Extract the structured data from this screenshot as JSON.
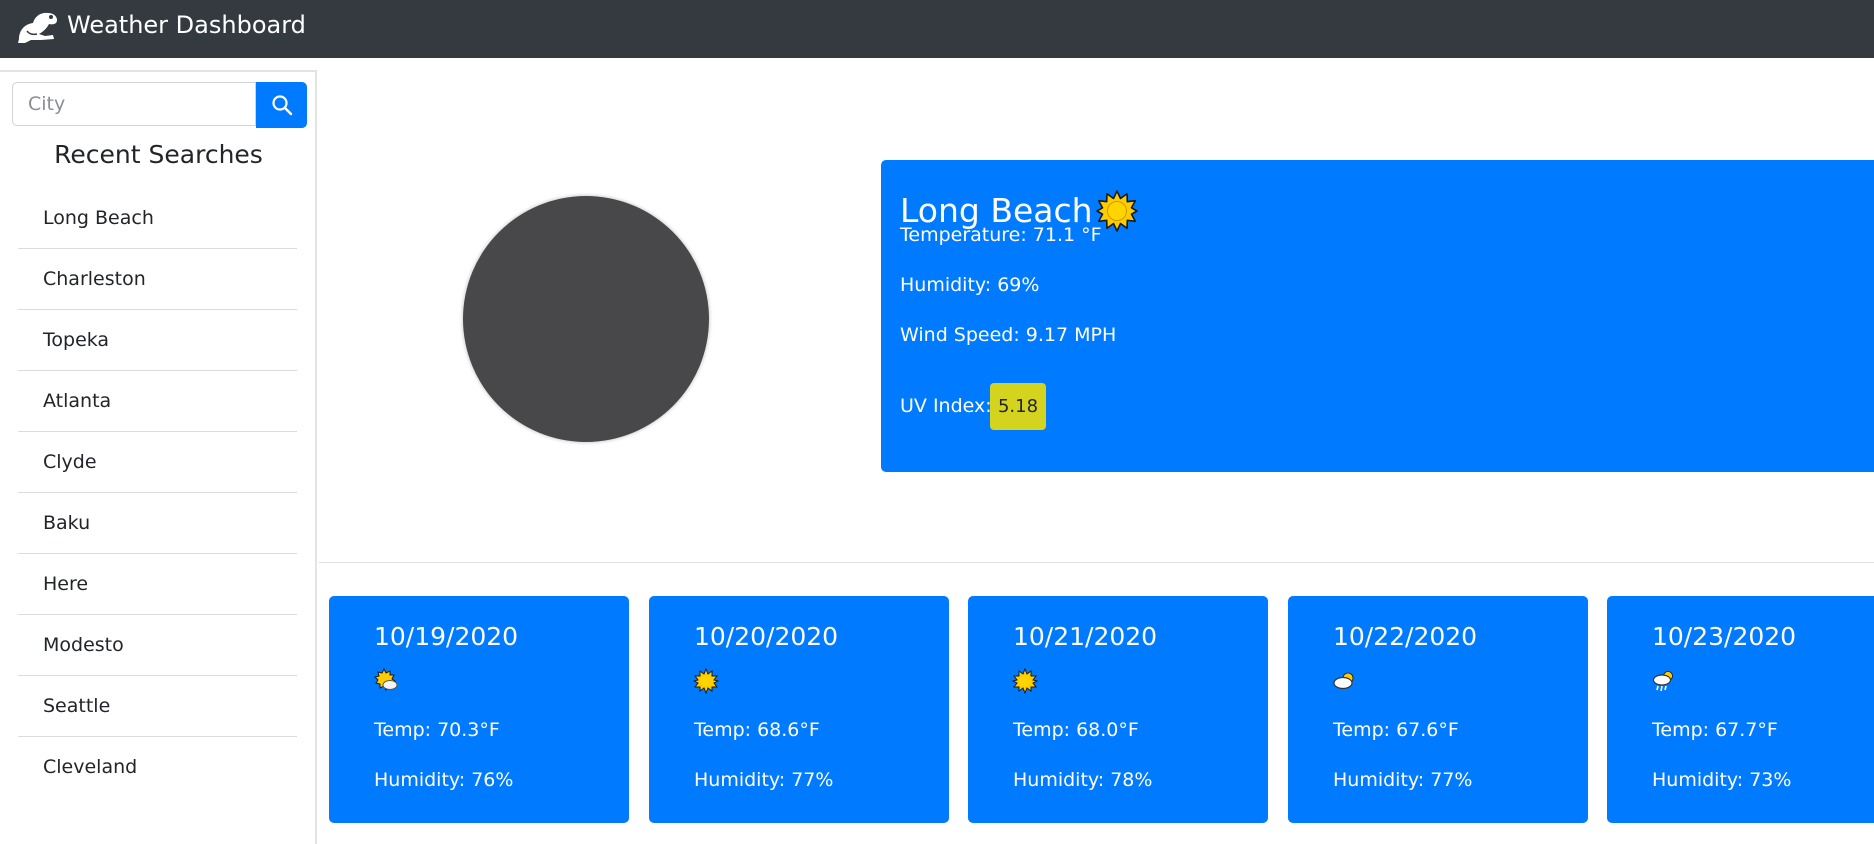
{
  "header": {
    "title": "Weather Dashboard",
    "logo_icon": "frog-icon"
  },
  "search": {
    "placeholder": "City",
    "value": "",
    "button_icon": "search-icon"
  },
  "recent": {
    "title": "Recent Searches",
    "items": [
      "Long Beach",
      "Charleston",
      "Topeka",
      "Atlanta",
      "Clyde",
      "Baku",
      "Here",
      "Modesto",
      "Seattle",
      "Cleveland"
    ]
  },
  "current": {
    "city": "Long Beach",
    "icon": "sun-icon",
    "temperature": "Temperature: 71.1 °F",
    "humidity": "Humidity: 69%",
    "wind": "Wind Speed: 9.17 MPH",
    "uv_label": "UV Index:",
    "uv_value": "5.18",
    "uv_color": "#d4d41f"
  },
  "forecast": [
    {
      "date": "10/19/2020",
      "icon": "sun-cloud-icon",
      "temp": "Temp: 70.3°F",
      "humidity": "Humidity: 76%"
    },
    {
      "date": "10/20/2020",
      "icon": "sun-icon",
      "temp": "Temp: 68.6°F",
      "humidity": "Humidity: 77%"
    },
    {
      "date": "10/21/2020",
      "icon": "sun-icon",
      "temp": "Temp: 68.0°F",
      "humidity": "Humidity: 78%"
    },
    {
      "date": "10/22/2020",
      "icon": "cloud-sun-icon",
      "temp": "Temp: 67.6°F",
      "humidity": "Humidity: 77%"
    },
    {
      "date": "10/23/2020",
      "icon": "rain-icon",
      "temp": "Temp: 67.7°F",
      "humidity": "Humidity: 73%"
    }
  ],
  "colors": {
    "navbar": "#343a40",
    "accent": "#007bff",
    "avatar": "#48484b"
  }
}
